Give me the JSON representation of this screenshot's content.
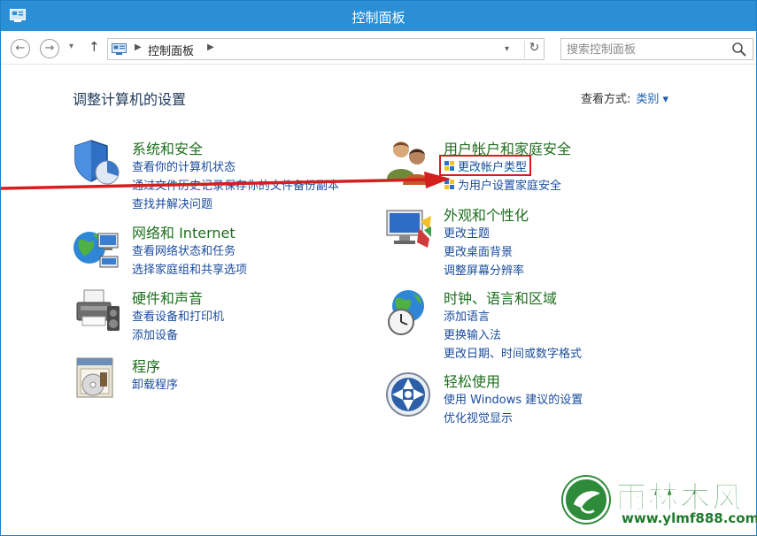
{
  "window": {
    "title": "控制面板"
  },
  "nav": {
    "back_glyph": "←",
    "forward_glyph": "→",
    "up_glyph": "↑",
    "dropdown_glyph": "▾",
    "refresh_glyph": "↻",
    "breadcrumb": "控制面板",
    "search_placeholder": "搜索控制面板"
  },
  "header": {
    "title": "调整计算机的设置",
    "view_by_label": "查看方式:",
    "view_by_value": "类别 ▾"
  },
  "categories": [
    {
      "icon": "shield-icon",
      "title": "系统和安全",
      "links": [
        "查看你的计算机状态",
        "通过文件历史记录保存你的文件备份副本",
        "查找并解决问题"
      ]
    },
    {
      "icon": "network-icon",
      "title": "网络和 Internet",
      "links": [
        "查看网络状态和任务",
        "选择家庭组和共享选项"
      ]
    },
    {
      "icon": "printer-icon",
      "title": "硬件和声音",
      "links": [
        "查看设备和打印机",
        "添加设备"
      ]
    },
    {
      "icon": "programs-icon",
      "title": "程序",
      "links": [
        "卸载程序"
      ]
    },
    {
      "icon": "users-icon",
      "title": "用户帐户和家庭安全",
      "links": [
        "更改帐户类型",
        "为用户设置家庭安全"
      ]
    },
    {
      "icon": "monitor-icon",
      "title": "外观和个性化",
      "links": [
        "更改主题",
        "更改桌面背景",
        "调整屏幕分辨率"
      ]
    },
    {
      "icon": "globe-clock-icon",
      "title": "时钟、语言和区域",
      "links": [
        "添加语言",
        "更换输入法",
        "更改日期、时间或数字格式"
      ]
    },
    {
      "icon": "ease-of-access-icon",
      "title": "轻松使用",
      "links": [
        "使用 Windows 建议的设置",
        "优化视觉显示"
      ]
    }
  ],
  "watermark": {
    "brand": "雨林木风",
    "url": "www.ylmf888.com"
  },
  "colors": {
    "titlebar": "#2b8fd6",
    "category_title": "#1e6e1e",
    "link": "#1a4c9c",
    "highlight": "#d41f1f",
    "watermark": "#2b8a37"
  }
}
